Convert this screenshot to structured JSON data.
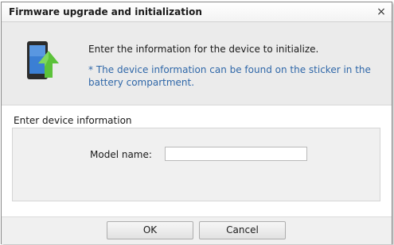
{
  "dialog": {
    "title": "Firmware upgrade and initialization",
    "close_symbol": "×"
  },
  "banner": {
    "icon": "device-upgrade-icon",
    "main_text": "Enter the information for the device to initialize.",
    "note_text": "* The device information can be found on the sticker in the battery compartment."
  },
  "form": {
    "section_label": "Enter device information",
    "model_name_label": "Model name:",
    "model_name_value": "",
    "model_name_placeholder": ""
  },
  "buttons": {
    "ok_label": "OK",
    "cancel_label": "Cancel"
  },
  "colors": {
    "note_text": "#2f67a8",
    "arrow_green": "#5cc23a",
    "device_body": "#2b2b2b",
    "device_screen": "#3b7fd4"
  }
}
